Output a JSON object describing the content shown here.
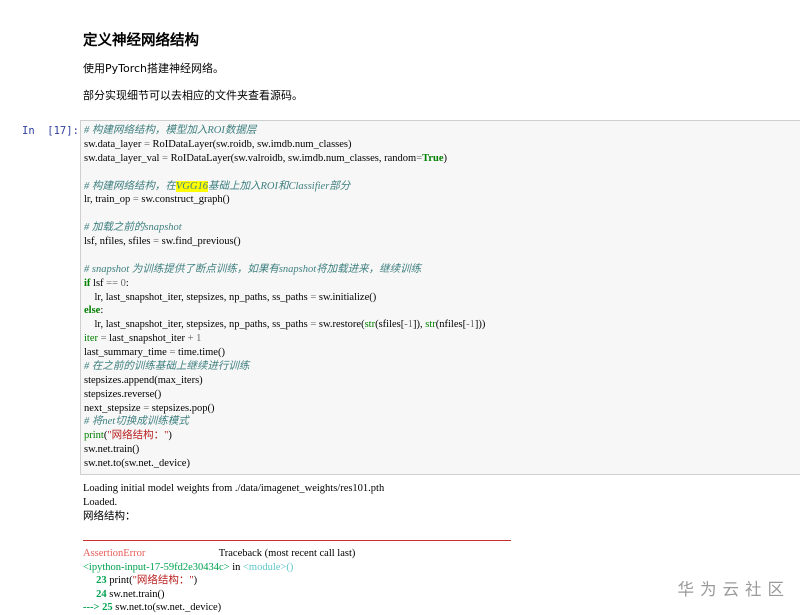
{
  "markdown": {
    "title": "定义神经网络结构",
    "para1": "使用PyTorch搭建神经网络。",
    "para2": "部分实现细节可以去相应的文件夹查看源码。"
  },
  "cell": {
    "prompt": "In  [17]:",
    "code": {
      "l1": "# 构建网络结构，模型加入ROI数据层",
      "l2a": "sw.data_layer ",
      "l2b": "=",
      "l2c": " RoIDataLayer(sw.roidb, sw.imdb.num_classes)",
      "l3a": "sw.data_layer_val ",
      "l3b": "=",
      "l3c": " RoIDataLayer(sw.valroidb, sw.imdb.num_classes, random",
      "l3d": "=",
      "l3e": "True",
      "l3f": ")",
      "l5a": "# 构建网络结构，在",
      "l5b": "VGG16",
      "l5c": "基础上加入ROI和Classifier部分",
      "l6a": "lr, train_op ",
      "l6b": "=",
      "l6c": " sw.construct_graph()",
      "l8": "# 加载之前的snapshot",
      "l9a": "lsf, nfiles, sfiles ",
      "l9b": "=",
      "l9c": " sw.find_previous()",
      "l11": "# snapshot 为训练提供了断点训练，如果有snapshot将加载进来，继续训练",
      "l12a": "if",
      "l12b": " lsf ",
      "l12c": "==",
      "l12d": " ",
      "l12e": "0",
      "l12f": ":",
      "l13a": "    lr, last_snapshot_iter, stepsizes, np_paths, ss_paths ",
      "l13b": "=",
      "l13c": " sw.initialize()",
      "l14a": "else",
      "l14b": ":",
      "l15a": "    lr, last_snapshot_iter, stepsizes, np_paths, ss_paths ",
      "l15b": "=",
      "l15c": " sw.restore(",
      "l15d": "str",
      "l15e": "(sfiles[",
      "l15f": "-",
      "l15g": "1",
      "l15h": "]), ",
      "l15i": "str",
      "l15j": "(nfiles[",
      "l15k": "-",
      "l15l": "1",
      "l15m": "]))",
      "l16a": "iter",
      "l16b": " ",
      "l16c": "=",
      "l16d": " last_snapshot_iter ",
      "l16e": "+",
      "l16f": " ",
      "l16g": "1",
      "l17a": "last_summary_time ",
      "l17b": "=",
      "l17c": " time.time()",
      "l18": "# 在之前的训练基础上继续进行训练",
      "l19": "stepsizes.append(max_iters)",
      "l20": "stepsizes.reverse()",
      "l21a": "next_stepsize ",
      "l21b": "=",
      "l21c": " stepsizes.pop()",
      "l22": "# 将net切换成训练模式",
      "l23a": "print",
      "l23b": "(",
      "l23c": "\"网络结构：\"",
      "l23d": ")",
      "l24": "sw.net.train()",
      "l25": "sw.net.to(sw.net._device)"
    },
    "output": {
      "o1": "Loading initial model weights from ./data/imagenet_weights/res101.pth",
      "o2": "Loaded.",
      "o3": "网络结构："
    },
    "error": {
      "e1a": "AssertionError",
      "e1b": "                            Traceback (most recent call last)",
      "e2a": "<ipython-input-17-59fd2e30434c>",
      "e2b": " in ",
      "e2c": "<module>",
      "e2d": "()",
      "e3a": "     23",
      "e3b": " print(",
      "e3c": "\"网络结构：\"",
      "e3d": ")",
      "e4a": "     24",
      "e4b": " sw.net.train()",
      "e5a": "---> 25",
      "e5b": " sw.net.to(sw.net._device)"
    }
  },
  "watermark": "华为云社区"
}
